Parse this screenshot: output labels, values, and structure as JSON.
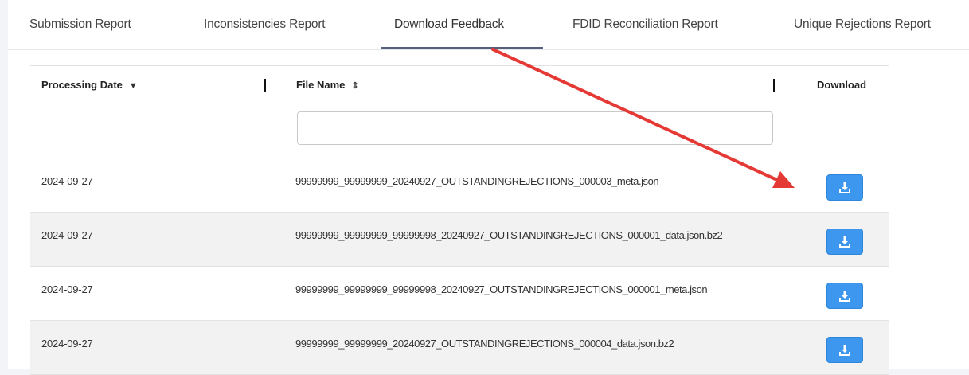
{
  "tabs": [
    {
      "label": "Submission Report"
    },
    {
      "label": "Inconsistencies Report"
    },
    {
      "label": "Download Feedback",
      "active": true
    },
    {
      "label": "FDID Reconciliation Report"
    },
    {
      "label": "Unique Rejections Report"
    }
  ],
  "table": {
    "columns": [
      {
        "label": "Processing Date",
        "sort": "descending"
      },
      {
        "label": "File Name",
        "sort": "sortable"
      },
      {
        "label": "Download"
      }
    ],
    "filter": {
      "value": "",
      "placeholder": ""
    },
    "rows": [
      {
        "date": "2024-09-27",
        "file_name": "99999999_99999999_20240927_OUTSTANDINGREJECTIONS_000003_meta.json",
        "download_icon": "download-icon"
      },
      {
        "date": "2024-09-27",
        "file_name": "99999999_99999999_99999998_20240927_OUTSTANDINGREJECTIONS_000001_data.json.bz2",
        "download_icon": "download-icon"
      },
      {
        "date": "2024-09-27",
        "file_name": "99999999_99999999_99999998_20240927_OUTSTANDINGREJECTIONS_000001_meta.json",
        "download_icon": "download-icon"
      },
      {
        "date": "2024-09-27",
        "file_name": "99999999_99999999_20240927_OUTSTANDINGREJECTIONS_000004_data.json.bz2",
        "download_icon": "download-icon"
      }
    ]
  },
  "colors": {
    "accent": "#3d97ee",
    "annotation_arrow": "#e53935",
    "active_tab_underline": "#55607a",
    "alt_row": "#f2f2f2"
  },
  "annotation": {
    "type": "arrow",
    "icon": "red-arrow"
  }
}
